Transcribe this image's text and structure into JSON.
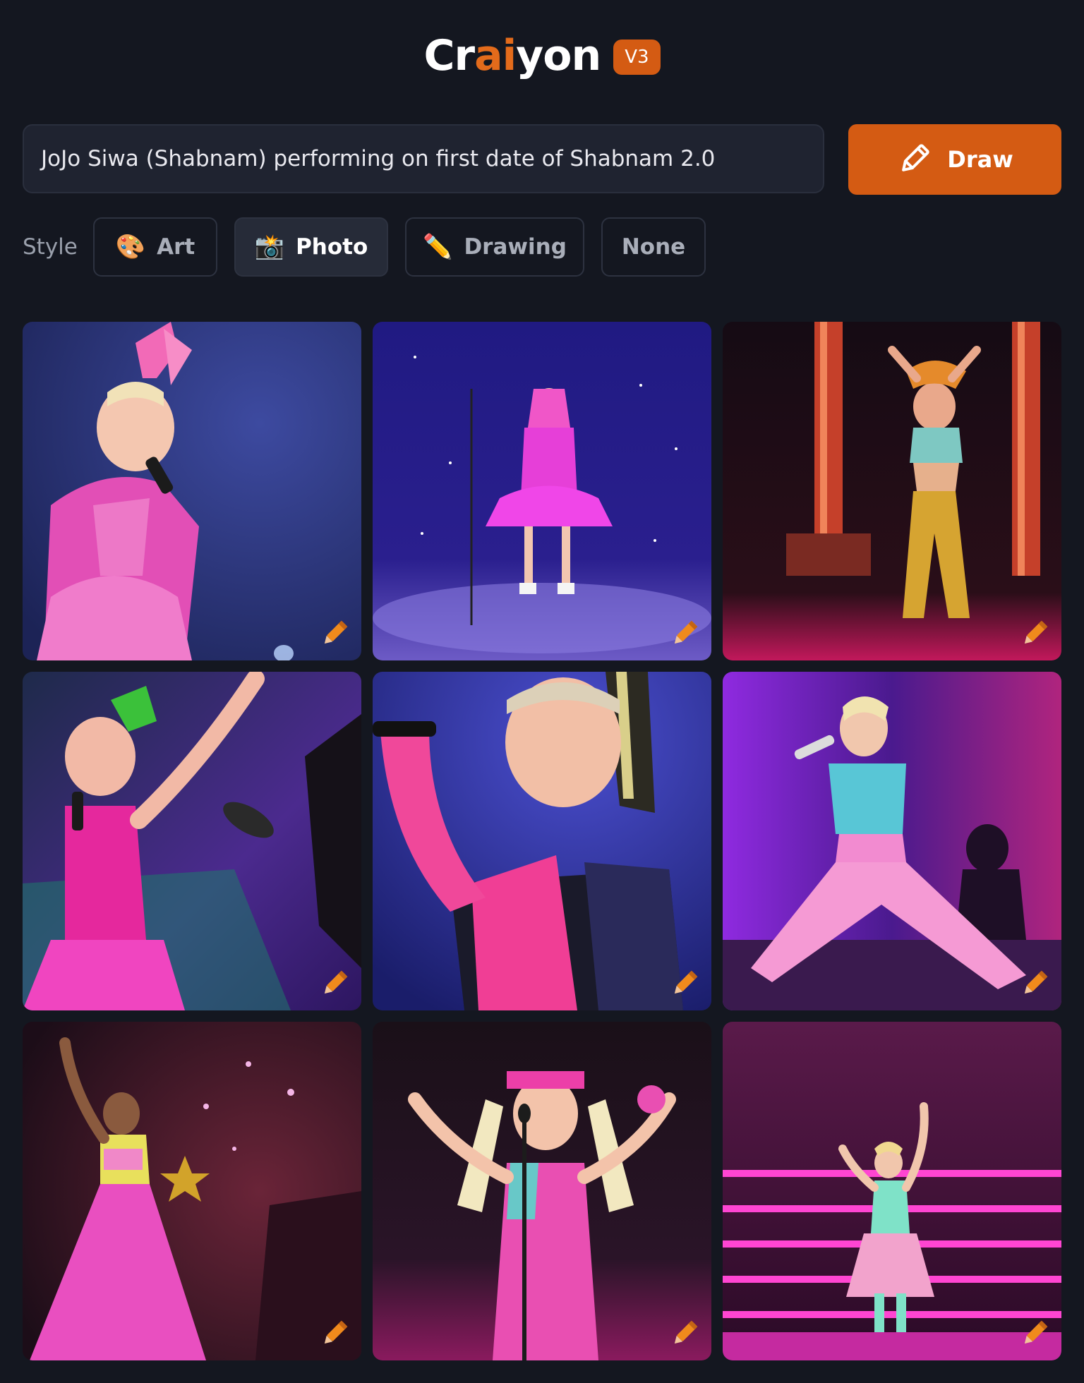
{
  "header": {
    "logo_prefix": "Cr",
    "logo_accent": "ai",
    "logo_suffix": "yon",
    "version": "V3",
    "accent_color": "#e36b1b"
  },
  "prompt": {
    "value": "JoJo Siwa (Shabnam) performing on first date of Shabnam 2.0"
  },
  "draw_button": {
    "label": "Draw",
    "icon": "pencil-icon"
  },
  "style": {
    "label": "Style",
    "selected": "Photo",
    "options": [
      {
        "label": "Art",
        "icon": "palette-icon",
        "emoji": "🎨"
      },
      {
        "label": "Photo",
        "icon": "camera-flash-icon",
        "emoji": "📸"
      },
      {
        "label": "Drawing",
        "icon": "pencil-icon",
        "emoji": "✏️"
      },
      {
        "label": "None",
        "icon": "",
        "emoji": ""
      }
    ]
  },
  "results": {
    "count": 9,
    "tile_icon": "pencil-edit-icon",
    "images": [
      {
        "subject": "girl in pink sequin dress with big pink bow singing into microphone",
        "palette": [
          "#2a3472",
          "#e04fb6"
        ]
      },
      {
        "subject": "girl in fuchsia tutu dress on purple starry stage with mic stand",
        "palette": [
          "#1b1670",
          "#e23fe6"
        ]
      },
      {
        "subject": "dancer in gold pants and jeweled top between red columns",
        "palette": [
          "#150b12",
          "#c0392b"
        ]
      },
      {
        "subject": "girl in pink satin vest with green bow singing, arm raised",
        "palette": [
          "#3a2a6e",
          "#e53fb2"
        ]
      },
      {
        "subject": "close-up of girl singing in sequin jacket with pink glove",
        "palette": [
          "#2b2f8c",
          "#ef3f9a"
        ]
      },
      {
        "subject": "girl in colorful sequined top and pink pants doing a split",
        "palette": [
          "#6a1bb0",
          "#f07ac6"
        ]
      },
      {
        "subject": "girl in long pink ballgown raising a hand on stage",
        "palette": [
          "#2a1326",
          "#ea4fbd"
        ]
      },
      {
        "subject": "girl in pink dress at microphone stand waving hands",
        "palette": [
          "#1a1020",
          "#e451a6"
        ]
      },
      {
        "subject": "child in mint and pink tutu on neon pink stairs",
        "palette": [
          "#5a0f48",
          "#ff3cc8"
        ]
      }
    ]
  }
}
